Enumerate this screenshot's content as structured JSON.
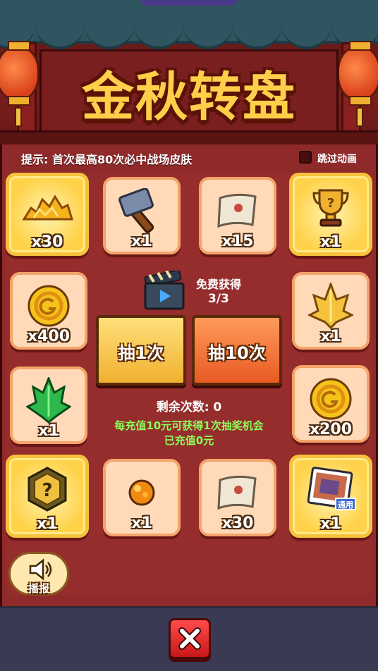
{
  "header": {
    "title": "金秋转盘"
  },
  "hint": "提示: 首次最高80次必中战场皮肤",
  "skip_animation": {
    "label": "跳过动画",
    "checked": false
  },
  "prizes": [
    {
      "icon": "gold-nuggets-icon",
      "qty": "x30",
      "style": "gold"
    },
    {
      "icon": "hammer-icon",
      "qty": "x1",
      "style": "normal"
    },
    {
      "icon": "scroll-icon",
      "qty": "x15",
      "style": "normal"
    },
    {
      "icon": "trophy-icon",
      "qty": "x1",
      "style": "gold"
    },
    {
      "icon": "gold-coin-icon",
      "qty": "x400",
      "style": "normal"
    },
    {
      "icon": "gold-crystal-icon",
      "qty": "x1",
      "style": "normal"
    },
    {
      "icon": "green-crystal-icon",
      "qty": "x1",
      "style": "normal"
    },
    {
      "icon": "gold-coin-icon",
      "qty": "x200",
      "style": "normal"
    },
    {
      "icon": "mystery-box-icon",
      "qty": "x1",
      "style": "gold"
    },
    {
      "icon": "orange-orb-icon",
      "qty": "x1",
      "style": "normal"
    },
    {
      "icon": "scroll-icon",
      "qty": "x30",
      "style": "normal"
    },
    {
      "icon": "skin-card-icon",
      "qty": "x1",
      "style": "gold",
      "badge": "通用"
    }
  ],
  "free": {
    "label": "免费获得",
    "count": "3/3"
  },
  "draw_one": {
    "label": "抽1次"
  },
  "draw_ten": {
    "label": "抽10次"
  },
  "remaining": "剩余次数: 0",
  "recharge_info": "每充值10元可获得1次抽奖机会",
  "recharged": "已充值0元",
  "broadcast": {
    "label": "播报"
  },
  "colors": {
    "accent_gold": "#ffcf4a",
    "panel_red": "#8e2a2a",
    "green_text": "#8cff5a",
    "close_red": "#e02a2a"
  }
}
